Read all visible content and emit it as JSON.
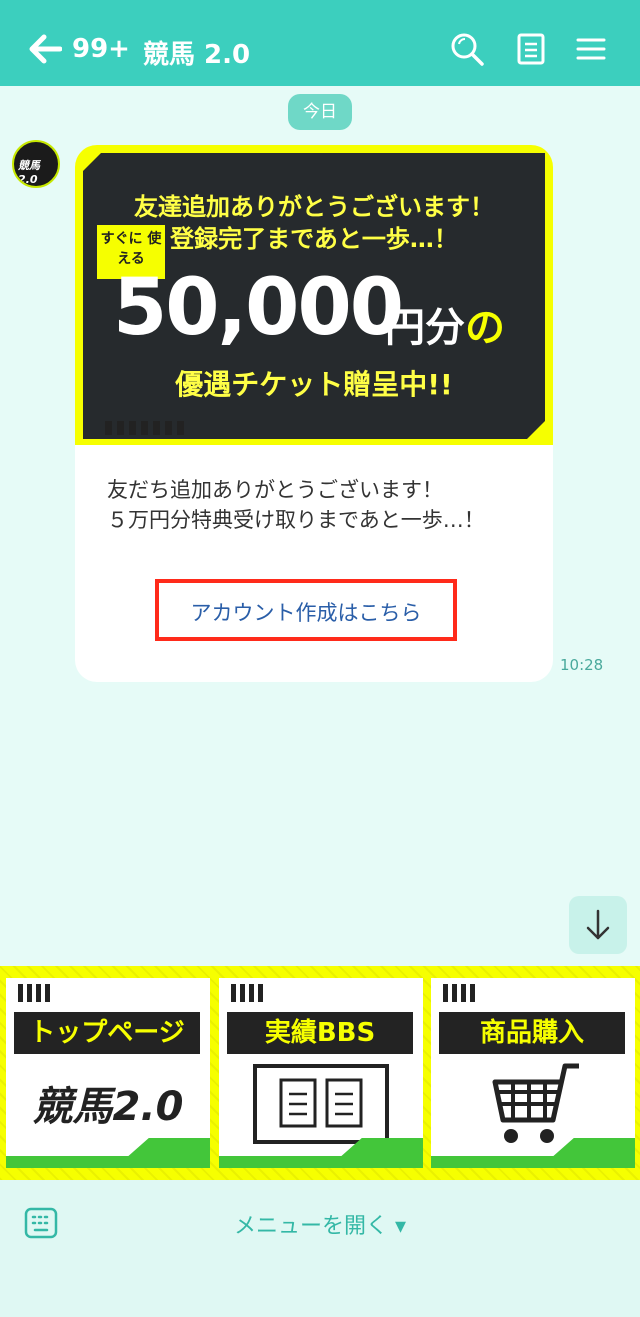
{
  "header": {
    "unread_count": "99+",
    "title": "競馬 2.0",
    "icons": [
      "back-arrow-icon",
      "search-icon",
      "notes-icon",
      "menu-icon"
    ]
  },
  "chat": {
    "date_label": "今日",
    "banner": {
      "line1": "友達追加ありがとうございます！",
      "line2": "登録完了まであと一歩…！",
      "badge": "すぐに 使える",
      "amount": "50,000",
      "unit": "円分",
      "unit_suffix": "の",
      "line3": "優遇チケット贈呈中!!"
    },
    "message": "友だち追加ありがとうございます！\n５万円分特典受け取りまであと一歩…！",
    "link_text": "アカウント作成はこちら",
    "time": "10:28"
  },
  "rich_menu": {
    "items": [
      {
        "label": "トップページ",
        "sub": "競馬2.0"
      },
      {
        "label": "実績BBS"
      },
      {
        "label": "商品購入"
      }
    ]
  },
  "bottom_bar": {
    "menu_label": "メニューを開く ▾"
  },
  "colors": {
    "header": "#3ccfbe",
    "background": "#e6fbf7",
    "accent_yellow": "#f6ff00",
    "highlight_red": "#ff2a1a",
    "link_blue": "#2a5ea8"
  }
}
